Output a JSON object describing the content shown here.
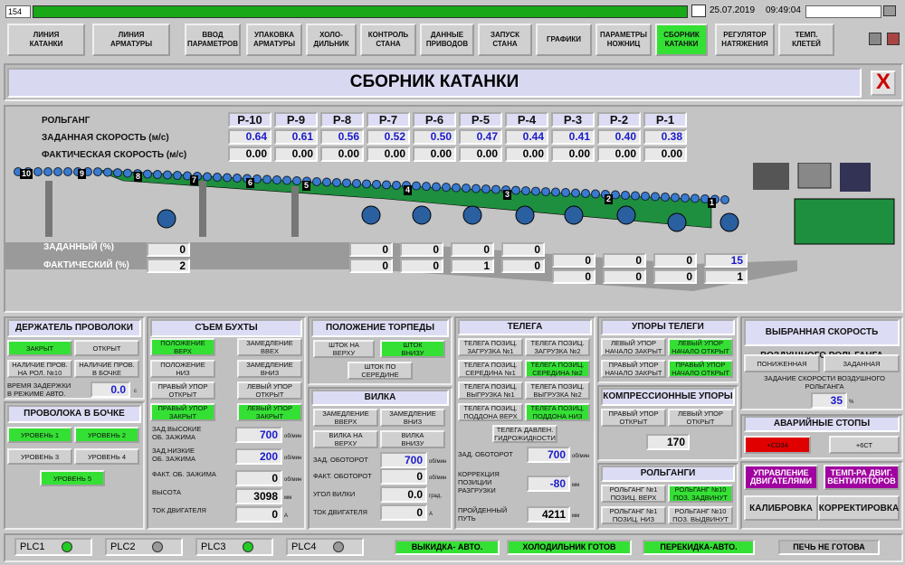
{
  "top": {
    "field": "154",
    "date": "25.07.2019",
    "time": "09:49:04"
  },
  "nav": [
    {
      "label": "ЛИНИЯ\nКАТАНКИ"
    },
    {
      "label": "ЛИНИЯ\nАРМАТУРЫ"
    },
    {
      "label": "ВВОД\nПАРАМЕТРОВ"
    },
    {
      "label": "УПАКОВКА\nАРМАТУРЫ"
    },
    {
      "label": "ХОЛО-\nДИЛЬНИК"
    },
    {
      "label": "КОНТРОЛЬ\nСТАНА"
    },
    {
      "label": "ДАННЫЕ\nПРИВОДОВ"
    },
    {
      "label": "ЗАПУСК\nСТАНА"
    },
    {
      "label": "ГРАФИКИ"
    },
    {
      "label": "ПАРАМЕТРЫ\nНОЖНИЦ"
    },
    {
      "label": "СБОРНИК\nКАТАНКИ"
    },
    {
      "label": "РЕГУЛЯТОР\nНАТЯЖЕНИЯ"
    },
    {
      "label": "ТЕМП.\nКЛЕТЕЙ"
    }
  ],
  "page_title": "СБОРНИК КАТАНКИ",
  "close_label": "X",
  "table": {
    "row1": "РОЛЬГАНГ",
    "row2": "ЗАДАННАЯ СКОРОСТЬ (м/с)",
    "row3": "ФАКТИЧЕСКАЯ СКОРОСТЬ (м/с)",
    "cols": [
      "P-10",
      "P-9",
      "P-8",
      "P-7",
      "P-6",
      "P-5",
      "P-4",
      "P-3",
      "P-2",
      "P-1"
    ],
    "set": [
      "0.64",
      "0.61",
      "0.56",
      "0.52",
      "0.50",
      "0.47",
      "0.44",
      "0.41",
      "0.40",
      "0.38"
    ],
    "act": [
      "0.00",
      "0.00",
      "0.00",
      "0.00",
      "0.00",
      "0.00",
      "0.00",
      "0.00",
      "0.00",
      "0.00"
    ]
  },
  "diagram": {
    "markers": [
      "10",
      "9",
      "8",
      "7",
      "6",
      "5",
      "4",
      "3",
      "2",
      "1"
    ],
    "set_label": "ЗАДАННЫЙ (%)",
    "act_label": "ФАКТИЧЕСКИЙ (%)",
    "set_vals": [
      "0",
      "0",
      "0",
      "0",
      "0",
      "0",
      "0",
      "0",
      "15"
    ],
    "act_vals": [
      "2",
      "0",
      "0",
      "1",
      "0",
      "0",
      "0",
      "0",
      "1"
    ]
  },
  "holder": {
    "title": "ДЕРЖАТЕЛЬ ПРОВОЛОКИ",
    "closed": "ЗАКРЫТ",
    "open": "ОТКРЫТ",
    "l1": "НАЛИЧИЕ ПРОВ.\nНА РОЛ. №10",
    "l2": "НАЛИЧИЕ ПРОВ.\nВ БОЧКЕ",
    "delay": "ВРЕМЯ ЗАДЕРЖКИ\nВ РЕЖИМЕ АВТО.",
    "delay_val": "0.0",
    "delay_unit": "с"
  },
  "barrel": {
    "title": "ПРОВОЛОКА В БОЧКЕ",
    "l1": "УРОВЕНЬ 1",
    "l2": "УРОВЕНЬ 2",
    "l3": "УРОВЕНЬ 3",
    "l4": "УРОВЕНЬ 4",
    "l5": "УРОВЕНЬ 5"
  },
  "coil": {
    "title": "СЪЕМ БУХТЫ",
    "b1": "ПОЛОЖЕНИЕ\nВЕРХ",
    "b2": "ЗАМЕДЛЕНИЕ\nВВЕХ",
    "b3": "ПОЛОЖЕНИЕ\nНИЗ",
    "b4": "ЗАМЕДЛЕНИЕ\nВНИЗ",
    "b5": "ПРАВЫЙ УПОР\nОТКРЫТ",
    "b6": "ЛЕВЫЙ УПОР\nОТКРЫТ",
    "b7": "ПРАВЫЙ УПОР\nЗАКРЫТ",
    "b8": "ЛЕВЫЙ УПОР\nЗАКРЫТ",
    "r1": "ЗАД.ВЫСОКИЕ\nОБ. ЗАЖИМА",
    "v1": "700",
    "u1": "об/мин",
    "r2": "ЗАД.НИЗКИЕ\nОБ. ЗАЖИМА",
    "v2": "200",
    "u2": "об/мин",
    "r3": "ФАКТ. ОБ. ЗАЖИМА",
    "v3": "0",
    "u3": "об/мин",
    "r4": "ВЫСОТА",
    "v4": "3098",
    "u4": "мм",
    "r5": "ТОК ДВИГАТЕЛЯ",
    "v5": "0",
    "u5": "А"
  },
  "torpedo": {
    "title": "ПОЛОЖЕНИЕ ТОРПЕДЫ",
    "b1": "ШТОК НА\nВЕРХУ",
    "b2": "ШТОК\nВНИЗУ",
    "b3": "ШТОК ПО\nСЕРЕДИНЕ"
  },
  "fork": {
    "title": "ВИЛКА",
    "b1": "ЗАМЕДЛЕНИЕ\nВВЕРХ",
    "b2": "ЗАМЕДЛЕНИЕ\nВНИЗ",
    "b3": "ВИЛКА НА\nВЕРХУ",
    "b4": "ВИЛКА\nВНИЗУ",
    "r1": "ЗАД. ОБОТОРОТ",
    "v1": "700",
    "u1": "об/мин",
    "r2": "ФАКТ. ОБОТОРОТ",
    "v2": "0",
    "u2": "об/мин",
    "r3": "УГОЛ ВИЛКИ",
    "v3": "0.0",
    "u3": "град.",
    "r4": "ТОК ДВИГАТЕЛЯ",
    "v4": "0",
    "u4": "А"
  },
  "cart": {
    "title": "ТЕЛЕГА",
    "b1": "ТЕЛЕГА ПОЗИЦ.\nЗАГРУЗКА №1",
    "b2": "ТЕЛЕГА ПОЗИЦ.\nЗАГРУЗКА №2",
    "b3": "ТЕЛЕГА ПОЗИЦ.\nСЕРЕДИНА №1",
    "b4": "ТЕЛЕГА ПОЗИЦ.\nСЕРЕДИНА №2",
    "b5": "ТЕЛЕГА ПОЗИЦ.\nВЫГРУЗКА №1",
    "b6": "ТЕЛЕГА ПОЗИЦ.\nВЫГРУЗКА №2",
    "b7": "ТЕЛЕГА ПОЗИЦ.\nПОДДОНА ВЕРХ",
    "b8": "ТЕЛЕГА ПОЗИЦ.\nПОДДОНА НИЗ",
    "b9": "ТЕЛЕГА ДАВЛЕН.\nГИДРОЖИДКОСТИ",
    "r1": "ЗАД. ОБОТОРОТ",
    "v1": "700",
    "u1": "об/мин",
    "r2": "КОРРЕКЦИЯ\nПОЗИЦИИ\nРАЗГРУЗКИ",
    "v2": "-80",
    "u2": "мм",
    "r3": "ПРОЙДЕННЫЙ\nПУТЬ",
    "v3": "4211",
    "u3": "мм"
  },
  "stops": {
    "title": "УПОРЫ ТЕЛЕГИ",
    "b1": "ЛЕВЫЙ УПОР\nНАЧАЛО ЗАКРЫТ",
    "b2": "ЛЕВЫЙ УПОР\nНАЧАЛО ОТКРЫТ",
    "b3": "ПРАВЫЙ УПОР\nНАЧАЛО ЗАКРЫТ",
    "b4": "ПРАВЫЙ УПОР\nНАЧАЛО ОТКРЫТ"
  },
  "comp": {
    "title": "КОМПРЕССИОННЫЕ УПОРЫ",
    "b1": "ПРАВЫЙ УПОР\nОТКРЫТ",
    "b2": "ЛЕВЫЙ УПОР\nОТКРЫТ",
    "val": "170"
  },
  "roller": {
    "title": "РОЛЬГАНГИ",
    "b1": "РОЛЬГАНГ №1\nПОЗИЦ. ВЕРХ",
    "b2": "РОЛЬГАНГ №10\nПОЗ. ЗАДВИНУТ",
    "b3": "РОЛЬГАНГ №1\nПОЗИЦ. НИЗ",
    "b4": "РОЛЬГАНГ №10\nПОЗ. ВЫДВИНУТ"
  },
  "air": {
    "title": "ВЫБРАННАЯ СКОРОСТЬ\nВОЗДУШНОГО РОЛЬГАНГА",
    "b1": "ПОНИЖЕННАЯ",
    "b2": "ЗАДАННАЯ",
    "lbl": "ЗАДАНИЕ СКОРОСТИ ВОЗДУШНОГО\nРОЛЬГАНГА",
    "val": "35",
    "unit": "%"
  },
  "emerg": {
    "title": "АВАРИЙНЫЕ СТОПЫ",
    "b1": "+CD34",
    "b2": "+6СТ"
  },
  "ctrl": {
    "b1": "УПРАВЛЕНИЕ\nДВИГАТЕЛЯМИ",
    "b2": "ТЕМП-РА ДВИГ.\nВЕНТИЛЯТОРОВ",
    "b3": "КАЛИБРОВКА",
    "b4": "КОРРЕКТИРОВКА"
  },
  "plc": [
    "PLC1",
    "PLC2",
    "PLC3",
    "PLC4"
  ],
  "plc_colors": [
    "#22cc22",
    "#999999",
    "#22cc22",
    "#999999"
  ],
  "status": {
    "s1": "ВЫКИДКА- АВТО.",
    "s2": "ХОЛОДИЛЬНИК ГОТОВ",
    "s3": "ПЕРЕКИДКА-АВТО.",
    "s4": "ПЕЧЬ НЕ ГОТОВА"
  }
}
